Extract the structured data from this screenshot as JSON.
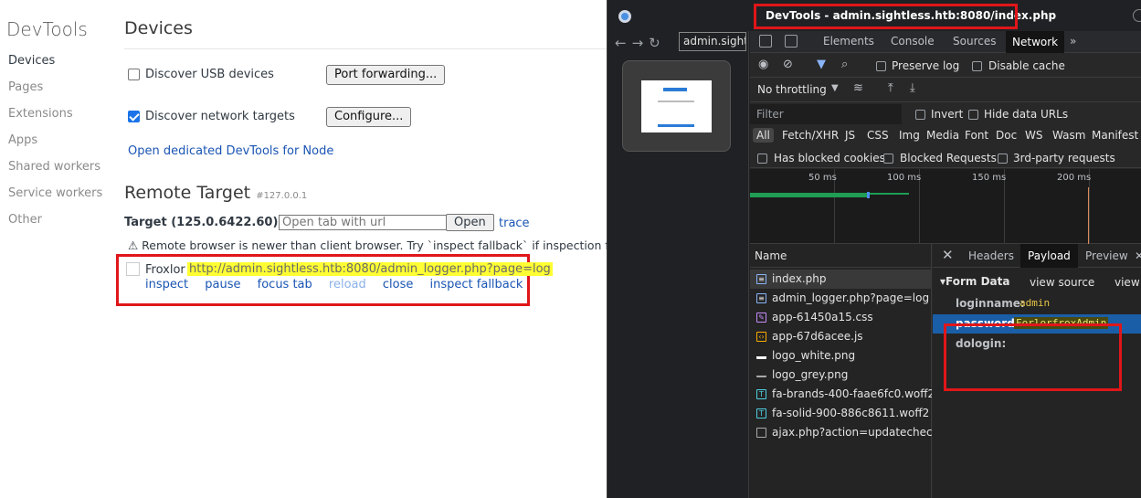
{
  "inspect": {
    "nav_title": "DevTools",
    "nav_items": [
      "Devices",
      "Pages",
      "Extensions",
      "Apps",
      "Shared workers",
      "Service workers",
      "Other"
    ],
    "heading": "Devices",
    "usb_label": "Discover USB devices",
    "port_btn": "Port forwarding...",
    "net_label": "Discover network targets",
    "configure_btn": "Configure...",
    "node_link": "Open dedicated DevTools for Node",
    "remote_title": "Remote Target",
    "remote_host": "#127.0.0.1",
    "target": "Target (125.0.6422.60)",
    "url_placeholder": "Open tab with url",
    "open_btn": "Open",
    "trace_link": "trace",
    "warning": "⚠ Remote browser is newer than client browser. Try `inspect fallback` if inspection fails.",
    "tab_name": "Froxlor",
    "tab_url": "http://admin.sightless.htb:8080/admin_logger.php?page=log",
    "actions": [
      "inspect",
      "pause",
      "focus tab",
      "reload",
      "close",
      "inspect fallback"
    ]
  },
  "devtools": {
    "window_title": "DevTools - admin.sightless.htb:8080/index.php",
    "address": "admin.sightl",
    "tabs": [
      "Elements",
      "Console",
      "Sources",
      "Network"
    ],
    "preserve_log": "Preserve log",
    "disable_cache": "Disable cache",
    "throttling": "No throttling",
    "filter_placeholder": "Filter",
    "invert": "Invert",
    "hide_data_urls": "Hide data URLs",
    "types": [
      "All",
      "Fetch/XHR",
      "JS",
      "CSS",
      "Img",
      "Media",
      "Font",
      "Doc",
      "WS",
      "Wasm",
      "Manifest"
    ],
    "blocked_cookies": "Has blocked cookies",
    "blocked_requests": "Blocked Requests",
    "third_party": "3rd-party requests",
    "ticks": [
      "50 ms",
      "100 ms",
      "150 ms",
      "200 ms"
    ],
    "name_header": "Name",
    "requests": [
      {
        "name": "index.php",
        "icon": "document-icon"
      },
      {
        "name": "admin_logger.php?page=log",
        "icon": "document-icon"
      },
      {
        "name": "app-61450a15.css",
        "icon": "stylesheet-icon"
      },
      {
        "name": "app-67d6acee.js",
        "icon": "script-icon"
      },
      {
        "name": "logo_white.png",
        "icon": "image-icon"
      },
      {
        "name": "logo_grey.png",
        "icon": "image-icon"
      },
      {
        "name": "fa-brands-400-faae6fc0.woff2",
        "icon": "font-icon"
      },
      {
        "name": "fa-solid-900-886c8611.woff2",
        "icon": "font-icon"
      },
      {
        "name": "ajax.php?action=updatechec…",
        "icon": "xhr-icon"
      }
    ],
    "detail_tabs": [
      "Headers",
      "Payload",
      "Preview"
    ],
    "form_data": "Form Data",
    "view_source": "view source",
    "view_url": "view U",
    "fields": [
      {
        "key": "loginname:",
        "value": "admin"
      },
      {
        "key": "password:",
        "value": "ForlorfroxAdmin"
      },
      {
        "key": "dologin:",
        "value": ""
      }
    ]
  },
  "colors": {
    "highlight_red": "#e0161a",
    "url_highlight": "#ffff33",
    "link_blue": "#1a55b3"
  }
}
